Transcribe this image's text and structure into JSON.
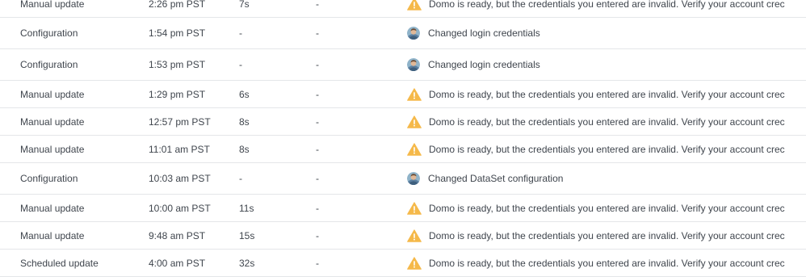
{
  "colors": {
    "text": "#3f454d",
    "divider": "#e4e6e9",
    "warning": "#f5b94a"
  },
  "rows": [
    {
      "type": "Manual update",
      "time": "2:26 pm PST",
      "duration": "7s",
      "rows": "-",
      "icon": "warning-icon",
      "message": "Domo is ready, but the credentials you entered are invalid. Verify your account crec"
    },
    {
      "type": "Configuration",
      "time": "1:54 pm PST",
      "duration": "-",
      "rows": "-",
      "icon": "user-avatar-icon",
      "message": "Changed login credentials"
    },
    {
      "type": "Configuration",
      "time": "1:53 pm PST",
      "duration": "-",
      "rows": "-",
      "icon": "user-avatar-icon",
      "message": "Changed login credentials"
    },
    {
      "type": "Manual update",
      "time": "1:29 pm PST",
      "duration": "6s",
      "rows": "-",
      "icon": "warning-icon",
      "message": "Domo is ready, but the credentials you entered are invalid. Verify your account crec"
    },
    {
      "type": "Manual update",
      "time": "12:57 pm PST",
      "duration": "8s",
      "rows": "-",
      "icon": "warning-icon",
      "message": "Domo is ready, but the credentials you entered are invalid. Verify your account crec"
    },
    {
      "type": "Manual update",
      "time": "11:01 am PST",
      "duration": "8s",
      "rows": "-",
      "icon": "warning-icon",
      "message": "Domo is ready, but the credentials you entered are invalid. Verify your account crec"
    },
    {
      "type": "Configuration",
      "time": "10:03 am PST",
      "duration": "-",
      "rows": "-",
      "icon": "user-avatar-icon",
      "message": "Changed DataSet configuration"
    },
    {
      "type": "Manual update",
      "time": "10:00 am PST",
      "duration": "11s",
      "rows": "-",
      "icon": "warning-icon",
      "message": "Domo is ready, but the credentials you entered are invalid. Verify your account crec"
    },
    {
      "type": "Manual update",
      "time": "9:48 am PST",
      "duration": "15s",
      "rows": "-",
      "icon": "warning-icon",
      "message": "Domo is ready, but the credentials you entered are invalid. Verify your account crec"
    },
    {
      "type": "Scheduled update",
      "time": "4:00 am PST",
      "duration": "32s",
      "rows": "-",
      "icon": "warning-icon",
      "message": "Domo is ready, but the credentials you entered are invalid. Verify your account crec"
    }
  ]
}
